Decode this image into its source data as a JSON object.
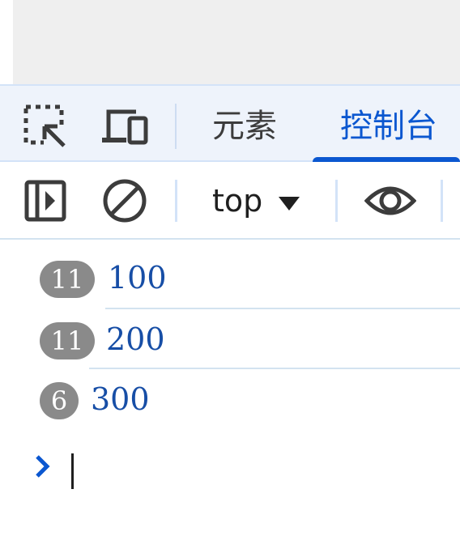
{
  "tabbar": {
    "tabs": [
      {
        "label": "元素"
      },
      {
        "label": "控制台"
      }
    ],
    "active_tab": "控制台"
  },
  "toolbar": {
    "context": "top"
  },
  "console": {
    "messages": [
      {
        "count": "11",
        "text": "100"
      },
      {
        "count": "11",
        "text": "200"
      },
      {
        "count": "6",
        "text": "300"
      }
    ],
    "prompt_value": ""
  },
  "colors": {
    "accent": "#0b57d0",
    "message_text": "#174ea6",
    "badge_bg": "#8a8a8a",
    "tabbar_bg": "#eef3fb"
  }
}
